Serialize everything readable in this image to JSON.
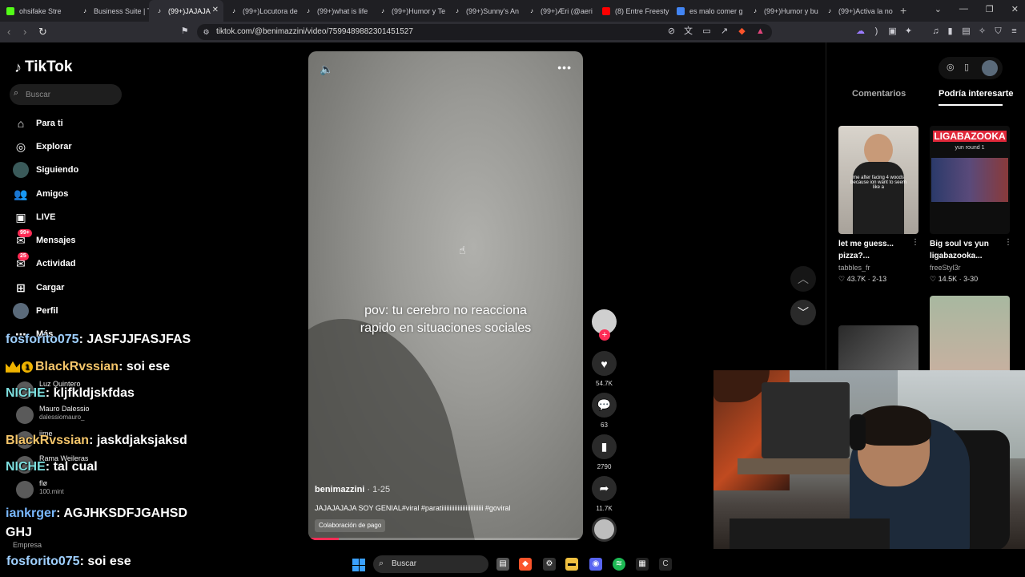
{
  "browser": {
    "tabs": [
      {
        "label": "ohsifake Stre",
        "icon": "kick-icon",
        "color": "#53fc18",
        "active": false
      },
      {
        "label": "Business Suite | T",
        "icon": "tiktok-icon",
        "color": "#ffffff",
        "active": false
      },
      {
        "label": "(99+)JAJAJA",
        "icon": "tiktok-icon",
        "color": "#ffffff",
        "active": true
      },
      {
        "label": "(99+)Locutora de",
        "icon": "tiktok-icon",
        "color": "#ffffff",
        "active": false
      },
      {
        "label": "(99+)what is life",
        "icon": "tiktok-icon",
        "color": "#ffffff",
        "active": false
      },
      {
        "label": "(99+)Humor y Te",
        "icon": "tiktok-icon",
        "color": "#ffffff",
        "active": false
      },
      {
        "label": "(99+)Sunny's An",
        "icon": "tiktok-icon",
        "color": "#ffffff",
        "active": false
      },
      {
        "label": "(99+)Æri (@aeri",
        "icon": "tiktok-icon",
        "color": "#ffffff",
        "active": false
      },
      {
        "label": "(8) Entre Freesty",
        "icon": "youtube-icon",
        "color": "#ff0000",
        "active": false
      },
      {
        "label": "es malo comer g",
        "icon": "google-icon",
        "color": "#4285f4",
        "active": false
      },
      {
        "label": "(99+)Humor y bu",
        "icon": "tiktok-icon",
        "color": "#ffffff",
        "active": false
      },
      {
        "label": "(99+)Activa la no",
        "icon": "tiktok-icon",
        "color": "#ffffff",
        "active": false
      }
    ],
    "url": "tiktok.com/@benimazzini/video/7599489882301451527"
  },
  "sidebar": {
    "logo": "TikTok",
    "search_placeholder": "Buscar",
    "nav": [
      {
        "label": "Para ti",
        "icon": "home-icon",
        "glyph": "⌂"
      },
      {
        "label": "Explorar",
        "icon": "compass-icon",
        "glyph": "◎"
      },
      {
        "label": "Siguiendo",
        "icon": "following-avatar-icon",
        "glyph": "●"
      },
      {
        "label": "Amigos",
        "icon": "friends-icon",
        "glyph": "👥"
      },
      {
        "label": "LIVE",
        "icon": "live-icon",
        "glyph": "▣"
      },
      {
        "label": "Mensajes",
        "icon": "messages-icon",
        "glyph": "✉",
        "badge": "99+"
      },
      {
        "label": "Actividad",
        "icon": "activity-icon",
        "glyph": "✉",
        "badge": "25"
      },
      {
        "label": "Cargar",
        "icon": "upload-icon",
        "glyph": "⊞"
      },
      {
        "label": "Perfil",
        "icon": "profile-icon",
        "glyph": "●"
      },
      {
        "label": "Más",
        "icon": "more-icon",
        "glyph": "⋯"
      }
    ],
    "following": [
      {
        "name": "Luz Quintero",
        "handle": ""
      },
      {
        "name": "Mauro Dalessio",
        "handle": "dalessiomauro_"
      },
      {
        "name": "iime",
        "handle": ""
      },
      {
        "name": "Rama Weileras",
        "handle": ""
      },
      {
        "name": "flø",
        "handle": "100.mint"
      }
    ],
    "footer": "Empresa"
  },
  "chat": [
    {
      "user": "fosforito075",
      "text": "JASFJJFASJFAS"
    },
    {
      "user": "BlackRvssian",
      "text": "soi ese"
    },
    {
      "user": "NICHE",
      "text": "kljfkldjskfdas"
    },
    {
      "user": "BlackRvssian",
      "text": "jaskdjaksjaksd"
    },
    {
      "user": "NICHE",
      "text": "tal cual"
    },
    {
      "user": "iankrger",
      "text": "AGJHKSDFJGAHSD"
    },
    {
      "user": "",
      "text": "GHJ"
    },
    {
      "user": "fosforito075",
      "text": "soi ese"
    }
  ],
  "video": {
    "caption": "pov: tu cerebro no reacciona rapido en situaciones sociales",
    "author": "benimazzini",
    "date": "· 1-25",
    "description": "JAJAJAJAJA SOY GENIAL#viral #paratiiiiiiiiiiiiiiiiiiiiiiiiii #goviral",
    "collab": "Colaboración de pago",
    "progress": 0.11
  },
  "actions": {
    "likes": "54.7K",
    "comments": "63",
    "saves": "2790",
    "shares": "11.7K"
  },
  "right_panel": {
    "tabs": [
      "Comentarios",
      "Podría interesarte"
    ],
    "videos": [
      {
        "title": "let me guess... pizza?...",
        "author": "tabbles_fr",
        "likes": "43.7K",
        "date": "2-13",
        "overlay": "me after facing 4 woods because ion want to seem like a"
      },
      {
        "title": "Big soul vs yun ligabazooka...",
        "author": "freeStyl3r",
        "likes": "14.5K",
        "date": "3-30",
        "overlay": "LIGABAZOOKA"
      }
    ],
    "thumb2_sub": "yun round 1"
  },
  "taskbar": {
    "search_label": "Buscar"
  }
}
